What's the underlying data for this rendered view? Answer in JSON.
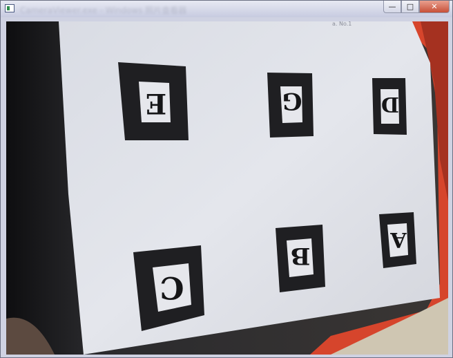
{
  "window": {
    "title": "CameraViewer.exe - Windows 照片查看器",
    "minimize_glyph": "—",
    "maximize_glyph": "□",
    "close_glyph": "✕"
  },
  "camera_view": {
    "note_text": "a. No.1",
    "markers": [
      {
        "letter": "E"
      },
      {
        "letter": "G"
      },
      {
        "letter": "D"
      },
      {
        "letter": "C"
      },
      {
        "letter": "B"
      },
      {
        "letter": "A"
      }
    ]
  }
}
